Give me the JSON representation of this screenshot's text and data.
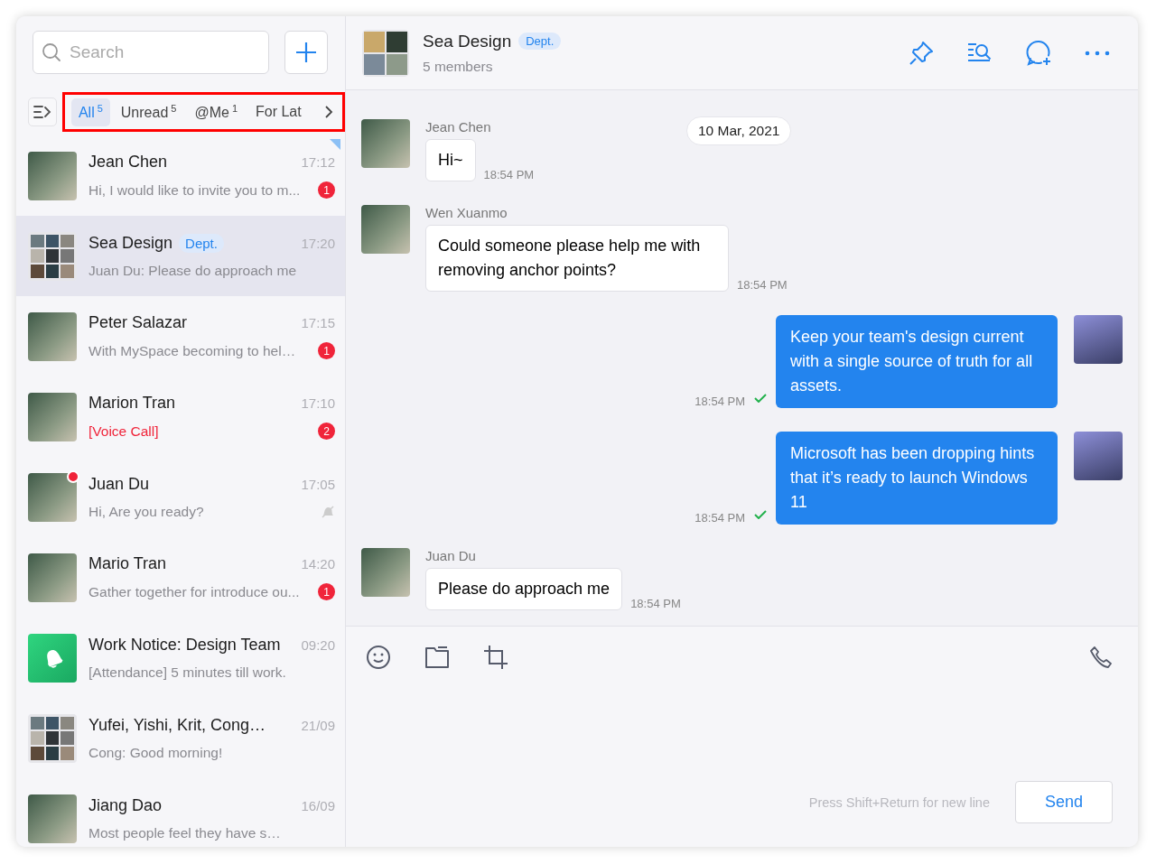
{
  "sidebar": {
    "search": {
      "placeholder": "Search"
    },
    "filters": [
      {
        "label": "All",
        "count": "5",
        "selected": true
      },
      {
        "label": "Unread",
        "count": "5",
        "selected": false
      },
      {
        "label": "@Me",
        "count": "1",
        "selected": false
      },
      {
        "label": "For Lat",
        "selected": false
      }
    ],
    "highlighted_filters": true,
    "conversations": [
      {
        "kind": "photo",
        "name": "Jean Chen",
        "time": "17:12",
        "preview": "Hi, I would like to invite you to m...",
        "missed_call": false,
        "badge": "1",
        "pinned": true,
        "muted": false,
        "online": false,
        "selected": false
      },
      {
        "kind": "grid",
        "name": "Sea Design",
        "tag": "Dept.",
        "time": "17:20",
        "preview": "Juan Du: Please do approach me",
        "missed_call": false,
        "pinned": false,
        "muted": false,
        "online": false,
        "selected": true
      },
      {
        "kind": "photo",
        "name": "Peter Salazar",
        "time": "17:15",
        "preview": "With MySpace becoming to hel…",
        "missed_call": false,
        "badge": "1",
        "pinned": false,
        "muted": false,
        "online": false,
        "selected": false
      },
      {
        "kind": "photo",
        "name": "Marion Tran",
        "time": "17:10",
        "preview": "[Voice Call]",
        "missed_call": true,
        "badge": "2",
        "pinned": false,
        "muted": false,
        "online": false,
        "selected": false
      },
      {
        "kind": "photo",
        "name": "Juan Du",
        "time": "17:05",
        "preview": "Hi, Are you ready?",
        "missed_call": false,
        "pinned": false,
        "muted": true,
        "online": true,
        "selected": false
      },
      {
        "kind": "photo",
        "name": "Mario Tran",
        "time": "14:20",
        "preview": "Gather together for introduce ou...",
        "missed_call": false,
        "badge": "1",
        "pinned": false,
        "muted": false,
        "online": false,
        "selected": false
      },
      {
        "kind": "bell",
        "name": "Work Notice: Design Team",
        "time": "09:20",
        "preview": "[Attendance] 5 minutes till work.",
        "missed_call": false,
        "pinned": false,
        "muted": false,
        "online": false,
        "selected": false
      },
      {
        "kind": "grid",
        "name": "Yufei, Yishi, Krit, Cong…",
        "time": "21/09",
        "preview": "Cong: Good morning!",
        "missed_call": false,
        "pinned": false,
        "muted": false,
        "online": false,
        "selected": false
      },
      {
        "kind": "photo",
        "name": "Jiang Dao",
        "time": "16/09",
        "preview": "Most people feel they have s…",
        "missed_call": false,
        "pinned": false,
        "muted": false,
        "online": false,
        "selected": false
      }
    ]
  },
  "chat": {
    "title": "Sea Design",
    "tag": "Dept.",
    "subtitle": "5 members",
    "date_divider": "10 Mar, 2021",
    "messages": [
      {
        "kind": "incoming",
        "sender": "Jean Chen",
        "text": "Hi~",
        "time": "18:54 PM"
      },
      {
        "kind": "incoming",
        "sender": "Wen Xuanmo",
        "text": "Could someone please help me with removing anchor points?",
        "time": "18:54 PM"
      },
      {
        "kind": "outgoing",
        "text": "Keep your team's design current with a single source of truth for all assets.",
        "time": "18:54 PM",
        "delivered": true
      },
      {
        "kind": "outgoing",
        "text": "Microsoft has been dropping hints that it’s ready to launch Windows 11",
        "time": "18:54 PM",
        "delivered": true
      },
      {
        "kind": "incoming",
        "sender": "Juan Du",
        "text": "Please do approach me",
        "time": "18:54 PM"
      }
    ],
    "composer": {
      "hint": "Press Shift+Return for new line",
      "send": "Send"
    }
  }
}
